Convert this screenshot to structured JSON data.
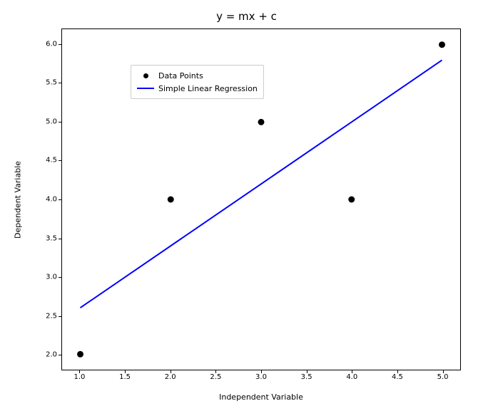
{
  "chart_data": {
    "type": "scatter",
    "title": "y = mx + c",
    "xlabel": "Independent Variable",
    "ylabel": "Dependent Variable",
    "xlim": [
      0.8,
      5.2
    ],
    "ylim": [
      1.8,
      6.2
    ],
    "xticks": [
      1.0,
      1.5,
      2.0,
      2.5,
      3.0,
      3.5,
      4.0,
      4.5,
      5.0
    ],
    "xtick_labels": [
      "1.0",
      "1.5",
      "2.0",
      "2.5",
      "3.0",
      "3.5",
      "4.0",
      "4.5",
      "5.0"
    ],
    "yticks": [
      2.0,
      2.5,
      3.0,
      3.5,
      4.0,
      4.5,
      5.0,
      5.5,
      6.0
    ],
    "ytick_labels": [
      "2.0",
      "2.5",
      "3.0",
      "3.5",
      "4.0",
      "4.5",
      "5.0",
      "5.5",
      "6.0"
    ],
    "series": [
      {
        "name": "Data Points",
        "kind": "scatter",
        "x": [
          1,
          2,
          3,
          4,
          5
        ],
        "y": [
          2,
          4,
          5,
          4,
          6
        ],
        "color": "#000000"
      },
      {
        "name": "Simple Linear Regression",
        "kind": "line",
        "x": [
          1,
          5
        ],
        "y": [
          2.6,
          5.8
        ],
        "color": "#0000ff",
        "slope": 0.8,
        "intercept": 1.8
      }
    ],
    "legend": {
      "loc": "upper left",
      "entries": [
        "Data Points",
        "Simple Linear Regression"
      ]
    }
  }
}
